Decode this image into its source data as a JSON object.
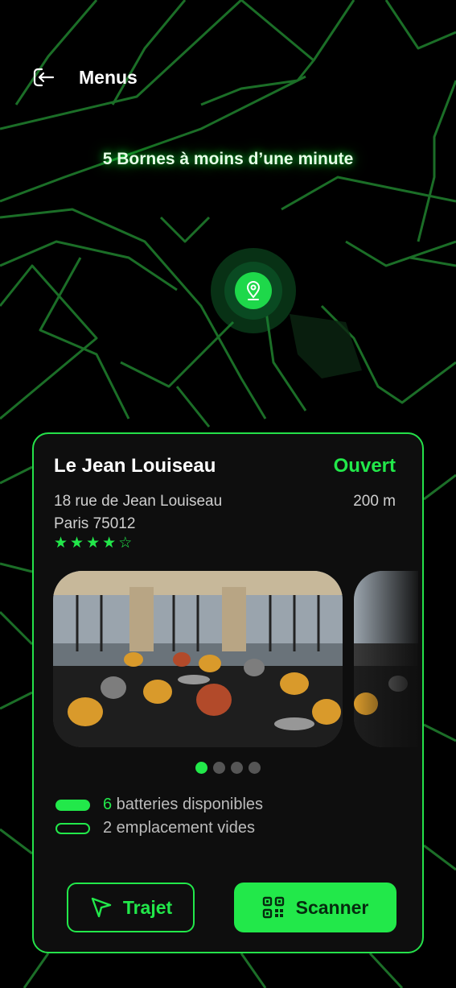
{
  "header": {
    "title": "Menus",
    "back_icon": "back-arrow-icon"
  },
  "bornes_text": "5 Bornes  à moins d’une minute",
  "map": {
    "line_color": "#1f7a2c",
    "pin_color": "#1ed84a"
  },
  "card": {
    "name": "Le Jean Louiseau",
    "status": "Ouvert",
    "address_line1": "18 rue de Jean Louiseau",
    "address_line2": "Paris 75012",
    "distance": "200 m",
    "rating": 4,
    "rating_max": 5,
    "photos_count": 4,
    "active_photo": 1,
    "batteries": {
      "count": "6",
      "label": " batteries disponibles"
    },
    "empty_slots": {
      "label": "2 emplacement vides"
    },
    "buttons": {
      "trajet": "Trajet",
      "scanner": "Scanner"
    }
  },
  "colors": {
    "accent": "#22e84a",
    "background": "#000000",
    "card": "#0e0e0e"
  }
}
